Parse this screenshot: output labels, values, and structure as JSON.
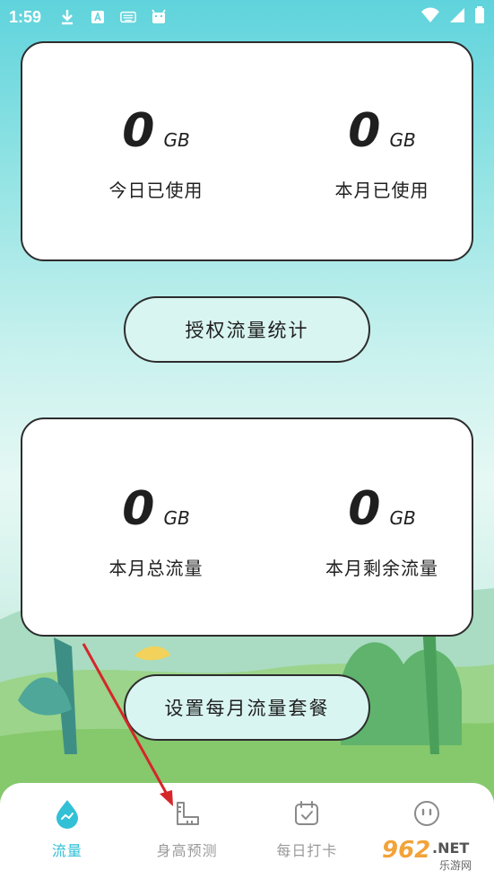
{
  "status_bar": {
    "time": "1:59",
    "icons": [
      "download-icon",
      "a-icon",
      "keyboard-icon",
      "android-icon",
      "wifi-icon",
      "signal-icon",
      "battery-icon"
    ]
  },
  "usage_card": {
    "today": {
      "value": "0",
      "unit": "GB",
      "label": "今日已使用"
    },
    "month": {
      "value": "0",
      "unit": "GB",
      "label": "本月已使用"
    }
  },
  "authorize_button": {
    "label": "授权流量统计"
  },
  "plan_card": {
    "total": {
      "value": "0",
      "unit": "GB",
      "label": "本月总流量"
    },
    "remaining": {
      "value": "0",
      "unit": "GB",
      "label": "本月剩余流量"
    }
  },
  "plan_button": {
    "label": "设置每月流量套餐"
  },
  "bottom_nav": {
    "items": [
      {
        "label": "流量",
        "icon": "water-drop-icon",
        "active": true
      },
      {
        "label": "身高预测",
        "icon": "ruler-icon",
        "active": false
      },
      {
        "label": "每日打卡",
        "icon": "calendar-check-icon",
        "active": false
      },
      {
        "label": "",
        "icon": "face-icon",
        "active": false
      }
    ]
  },
  "watermark": {
    "logo": "962",
    "net": ".NET",
    "sub": "乐游网"
  },
  "colors": {
    "accent": "#32c0d6",
    "pill_bg": "#d9f5f1",
    "border": "#2d2d2d",
    "arrow": "#d6262a"
  }
}
